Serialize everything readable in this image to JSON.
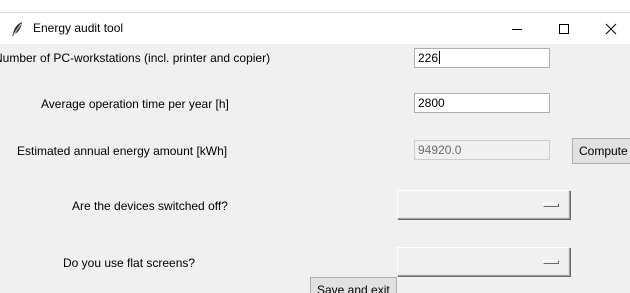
{
  "window": {
    "title": "Energy audit tool",
    "minimize_label": "minimize",
    "maximize_label": "maximize",
    "close_label": "close"
  },
  "form": {
    "workstations": {
      "label": "Number of PC-workstations (incl. printer and copier)",
      "value": "226"
    },
    "operation_time": {
      "label": "Average operation time per year [h]",
      "value": "2800"
    },
    "energy_amount": {
      "label": "Estimated annual energy amount [kWh]",
      "value": "94920.0"
    },
    "compute_button": "Compute",
    "switched_off": {
      "label": "Are the devices switched off?",
      "value": ""
    },
    "flat_screens": {
      "label": "Do you use flat screens?",
      "value": ""
    },
    "save_button": "Save and exit"
  },
  "icons": {
    "app": "feather-icon",
    "minimize": "minimize-icon",
    "maximize": "maximize-icon",
    "close": "close-icon",
    "dropdown": "option-menu-indicator-icon"
  },
  "colors": {
    "window_bg": "#f0f0f0",
    "titlebar_bg": "#ffffff",
    "entry_border": "#abadb3",
    "disabled_text": "#6d6d6d"
  }
}
